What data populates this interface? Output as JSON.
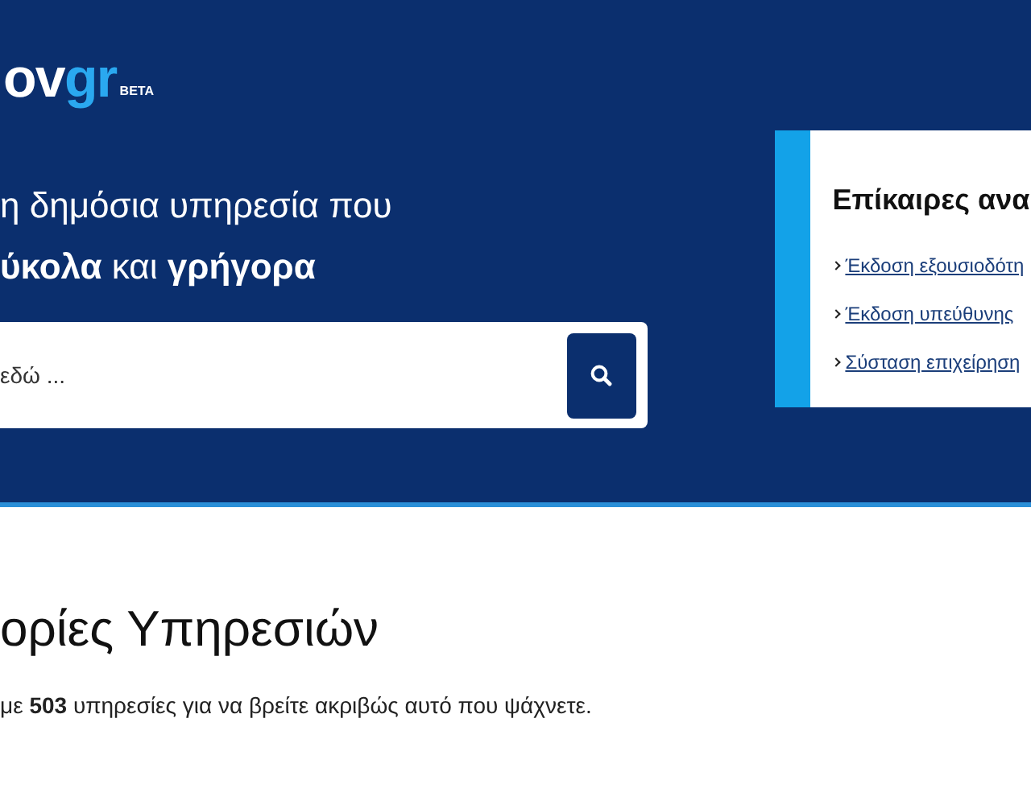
{
  "header": {
    "logo": {
      "text": "ov",
      "accent": "gr",
      "badge": "BETA"
    },
    "headline": [
      "η δημόσια υπηρεσία που",
      "**ύκολα** και **γρήγορα**"
    ],
    "search": {
      "placeholder": "εδώ ..."
    },
    "news_card": {
      "title": "Επίκαιρες ανα",
      "links": [
        "Έκδοση εξουσιοδότη",
        "Έκδοση υπεύθυνης",
        "Σύσταση επιχείρηση"
      ]
    }
  },
  "categories": {
    "title": "ορίες Υπηρεσιών",
    "description": "με **503** υπηρεσίες για να βρείτε ακριβώς αυτό που ψάχνετε."
  }
}
